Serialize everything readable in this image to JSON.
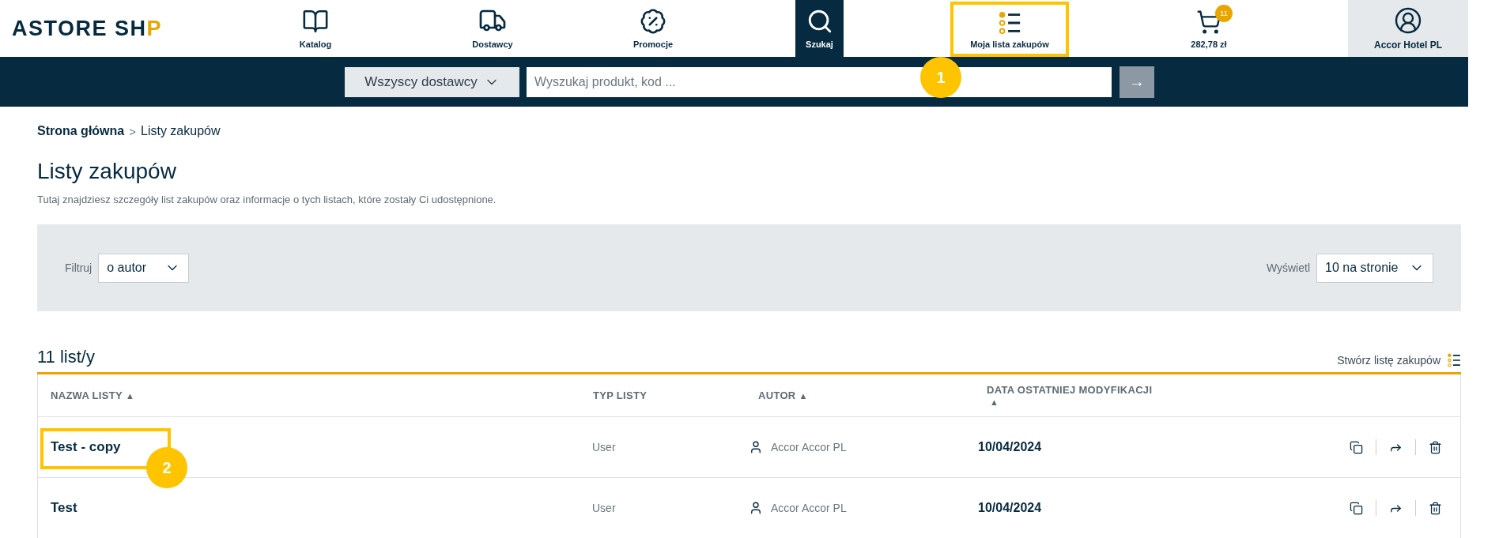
{
  "logo": {
    "text_before": "ASTORE SH",
    "text_after": "P"
  },
  "nav": [
    {
      "label": "Katalog",
      "selected": false
    },
    {
      "label": "Dostawcy",
      "selected": false
    },
    {
      "label": "Promocje",
      "selected": false
    },
    {
      "label": "Szukaj",
      "selected": true
    },
    {
      "label": "Moja lista zakupów",
      "selected": false,
      "annotation": "1"
    }
  ],
  "cart": {
    "badge": "11",
    "total": "282,78 zł"
  },
  "account": {
    "label": "Accor Hotel PL"
  },
  "search": {
    "supplier": "Wszyscy dostawcy",
    "placeholder": "Wyszukaj produkt, kod ...",
    "submit": "→"
  },
  "breadcrumb": [
    {
      "label": "Strona główna"
    },
    {
      "label": "Listy zakupów"
    }
  ],
  "breadcrumb_separator": ">",
  "title": "Listy zakupów",
  "description": "Tutaj znajdziesz szczegóły list zakupów oraz informacje o tych listach, które zostały Ci udostępnione.",
  "filters": {
    "filter_label": "Filtruj",
    "filter_value": "o autor",
    "display_label": "Wyświetl",
    "display_value": "10 na stronie"
  },
  "list_count": "11 list/y",
  "create_list": "Stwórz listę zakupów",
  "table": {
    "columns": [
      {
        "label": "NAZWA LISTY",
        "sort": "▲"
      },
      {
        "label": "TYP LISTY"
      },
      {
        "label": "AUTOR",
        "sort": "▲"
      },
      {
        "label": "DATA OSTATNIEJ MODYFIKACJI",
        "sort": "▲"
      }
    ],
    "rows": [
      {
        "name": "Test - copy",
        "type": "User",
        "author": "Accor Accor PL",
        "date": "10/04/2024",
        "annotation": "2"
      },
      {
        "name": "Test",
        "type": "User",
        "author": "Accor Accor PL",
        "date": "10/04/2024"
      }
    ]
  }
}
